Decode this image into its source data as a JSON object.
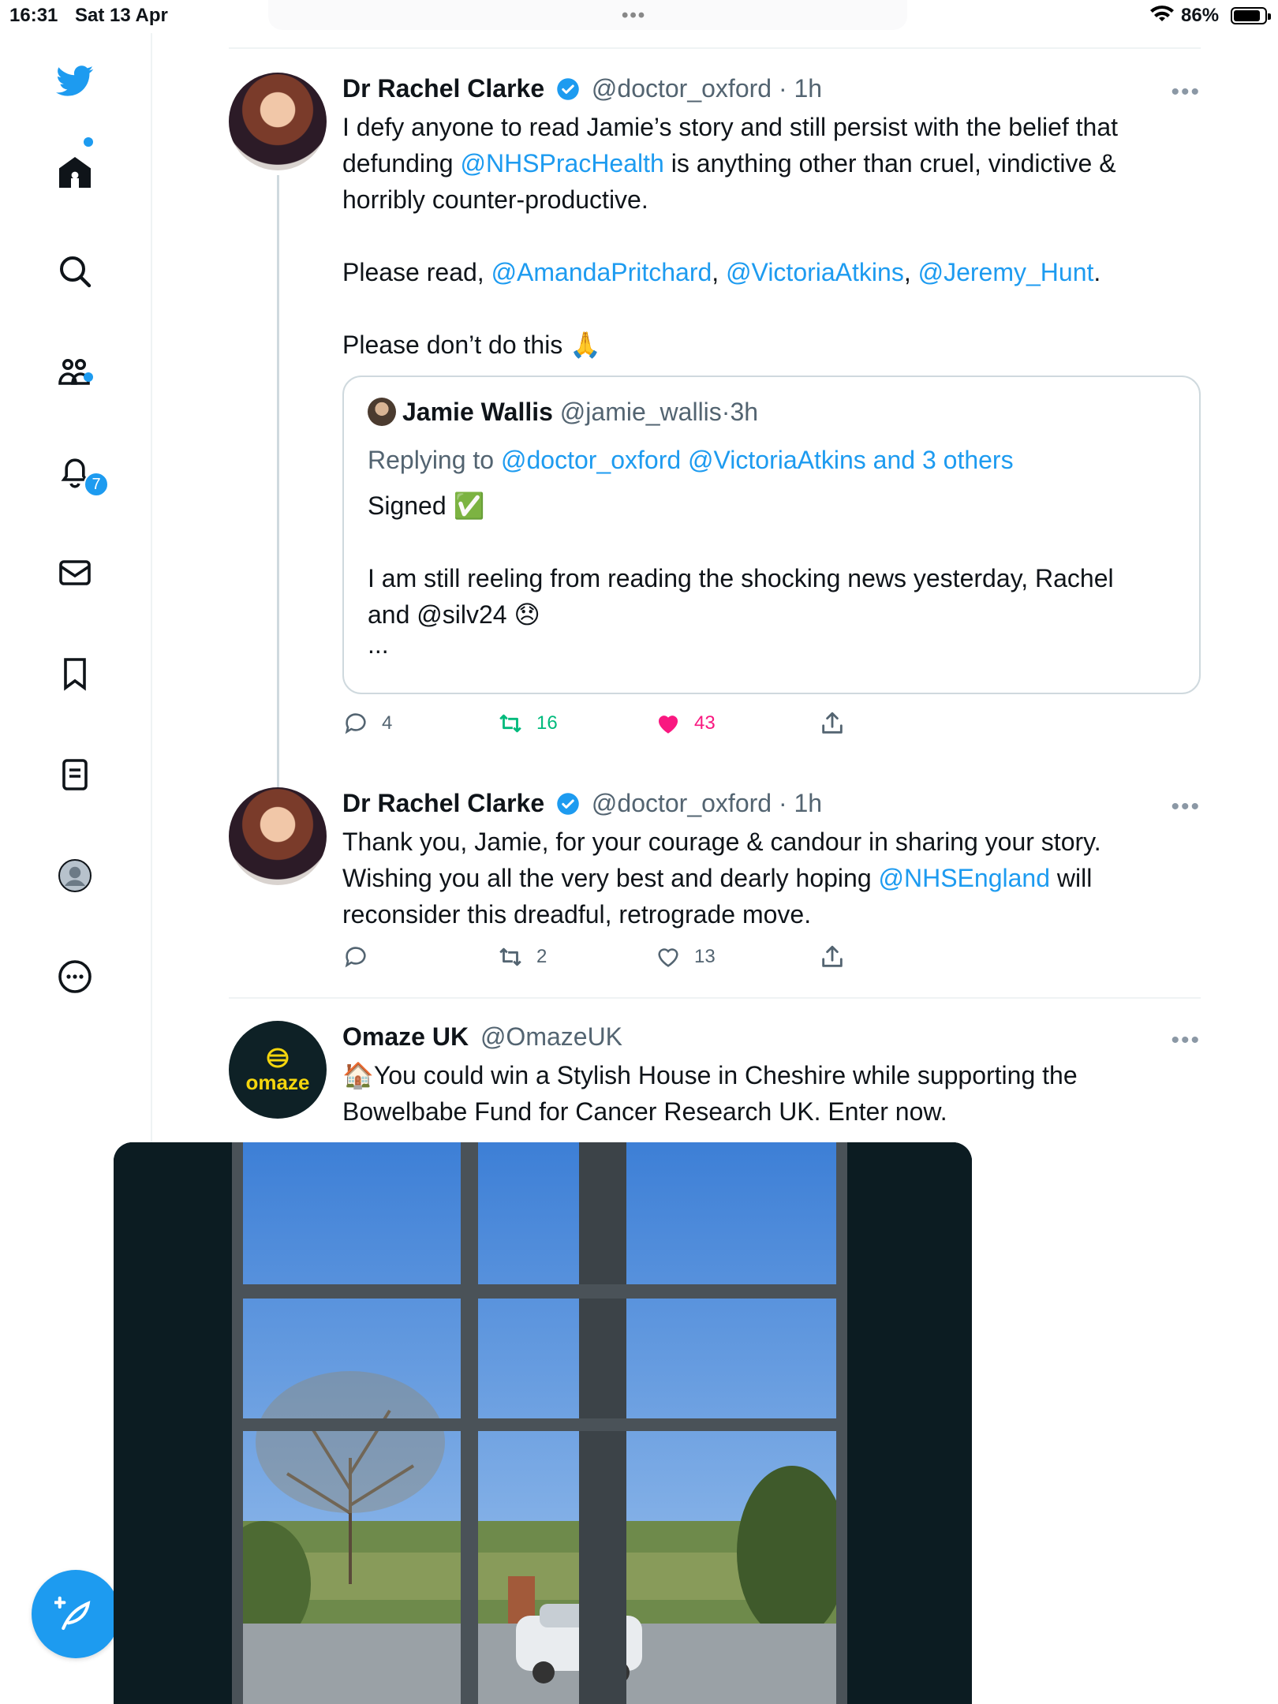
{
  "status_bar": {
    "time": "16:31",
    "date": "Sat 13 Apr",
    "battery": "86%",
    "battery_level": 0.86
  },
  "sidebar": {
    "items": [
      "home",
      "search",
      "communities",
      "notifications",
      "messages",
      "bookmarks",
      "lists",
      "profile",
      "more"
    ],
    "notifications_badge": "7"
  },
  "tweets": [
    {
      "name": "Dr Rachel Clarke",
      "handle": "@doctor_oxford",
      "sep": "·",
      "ago": "1h",
      "lines": [
        {
          "parts": [
            "I defy anyone to read Jamie’s story and still persist with the belief that"
          ]
        },
        {
          "parts": [
            "defunding ",
            "@NHSPracHealth",
            " is anything other than cruel, vindictive &"
          ]
        },
        {
          "parts": [
            "horribly counter-productive."
          ]
        },
        {
          "parts": [
            "Please read, ",
            "@AmandaPritchard",
            ", ",
            "@VictoriaAtkins",
            ", ",
            "@Jeremy_Hunt",
            "."
          ]
        },
        {
          "parts": [
            "Please don’t do this 🙏"
          ]
        }
      ],
      "quote": {
        "name": "Jamie Wallis",
        "handle": "@jamie_wallis",
        "sep": "·",
        "ago": "3h",
        "replying_prefix": "Replying to ",
        "replying_to": "@doctor_oxford @VictoriaAtkins and 3 others",
        "line1": "Signed ✅",
        "line2": "I am still reeling from reading the shocking news yesterday, Rachel",
        "line3": "and @silv24 😞",
        "line4": "..."
      },
      "replies": "4",
      "retweets": "16",
      "likes": "43"
    },
    {
      "name": "Dr Rachel Clarke",
      "handle": "@doctor_oxford",
      "sep": "·",
      "ago": "1h",
      "line1": "Thank you, Jamie, for your courage & candour in sharing your story.",
      "line2_a": "Wishing you all the very best and dearly hoping ",
      "line2_mention": "@NHSEngland",
      "line2_b": " will",
      "line3": "reconsider this dreadful, retrograde move.",
      "replies": "",
      "retweets": "2",
      "likes": "13"
    },
    {
      "name": "Omaze UK",
      "handle": "@OmazeUK",
      "avatar_text": "omaze",
      "line1": "🏠You could win a Stylish House in Cheshire while supporting the",
      "line2": "Bowelbabe Fund for Cancer Research UK. Enter now."
    }
  ],
  "colors": {
    "accent": "#1d9bf0",
    "retweet": "#00ba7c",
    "like": "#f91880",
    "omaze_bg": "#0e2126",
    "omaze_logo": "#f5d60d"
  }
}
